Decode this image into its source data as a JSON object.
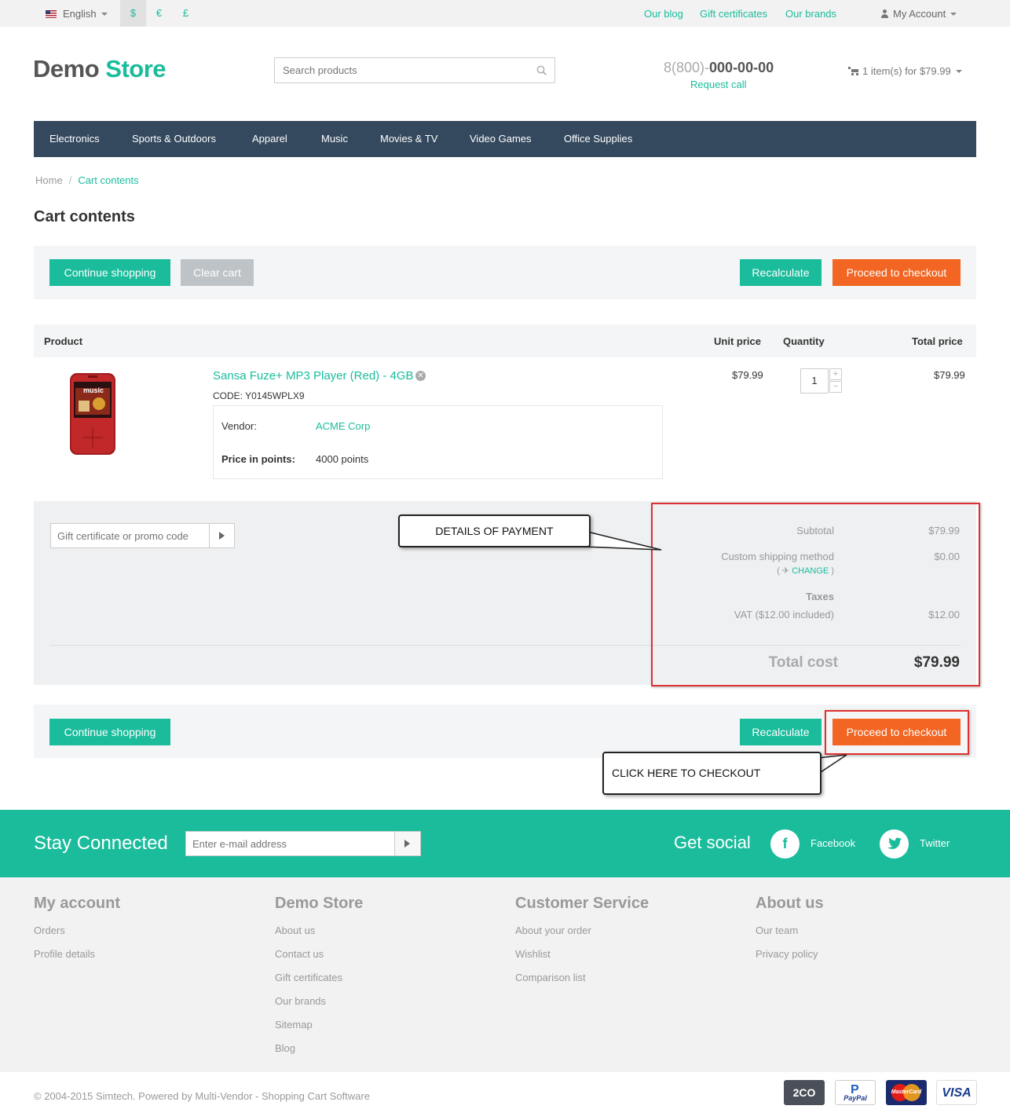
{
  "topbar": {
    "language": "English",
    "currencies": [
      "$",
      "€",
      "£"
    ],
    "links": [
      "Our blog",
      "Gift certificates",
      "Our brands"
    ],
    "account": "My Account"
  },
  "header": {
    "logo_part1": "Demo",
    "logo_part2": "Store",
    "search_placeholder": "Search products",
    "phone_prefix": "8(800)-",
    "phone_number": "000-00-00",
    "request_call": "Request call",
    "cart_summary": "1 item(s) for $79.99"
  },
  "nav": [
    "Electronics",
    "Sports & Outdoors",
    "Apparel",
    "Music",
    "Movies & TV",
    "Video Games",
    "Office Supplies"
  ],
  "breadcrumb": {
    "home": "Home",
    "separator": "/",
    "current": "Cart contents"
  },
  "page_title": "Cart contents",
  "buttons": {
    "continue_shopping": "Continue shopping",
    "clear_cart": "Clear cart",
    "recalculate": "Recalculate",
    "proceed_to_checkout": "Proceed to checkout"
  },
  "table": {
    "headers": {
      "product": "Product",
      "unit_price": "Unit price",
      "quantity": "Quantity",
      "total_price": "Total price"
    },
    "item": {
      "name": "Sansa Fuze+ MP3 Player (Red) - 4GB",
      "code": "CODE: Y0145WPLX9",
      "vendor_label": "Vendor:",
      "vendor": "ACME Corp",
      "points_label": "Price in points:",
      "points": "4000 points",
      "unit_price": "$79.99",
      "quantity": "1",
      "total_price": "$79.99",
      "image_text": "music"
    }
  },
  "summary": {
    "promo_placeholder": "Gift certificate or promo code",
    "subtotal_label": "Subtotal",
    "subtotal": "$79.99",
    "shipping_label": "Custom shipping method",
    "shipping_change": "CHANGE",
    "shipping": "$0.00",
    "taxes_label": "Taxes",
    "vat_label": "VAT ($12.00 included)",
    "vat": "$12.00",
    "total_label": "Total cost",
    "total": "$79.99"
  },
  "annotations": {
    "payment_details": "DETAILS OF PAYMENT",
    "click_checkout": "CLICK HERE TO CHECKOUT",
    "highlight_color": "#e03030"
  },
  "subscribe": {
    "title": "Stay Connected",
    "email_placeholder": "Enter e-mail address",
    "get_social": "Get social",
    "facebook": "Facebook",
    "twitter": "Twitter"
  },
  "footer": {
    "columns": [
      {
        "title": "My account",
        "links": [
          "Orders",
          "Profile details"
        ]
      },
      {
        "title": "Demo Store",
        "links": [
          "About us",
          "Contact us",
          "Gift certificates",
          "Our brands",
          "Sitemap",
          "Blog"
        ]
      },
      {
        "title": "Customer Service",
        "links": [
          "About your order",
          "Wishlist",
          "Comparison list"
        ]
      },
      {
        "title": "About us",
        "links": [
          "Our team",
          "Privacy policy"
        ]
      }
    ],
    "copyright": "© 2004-2015 Simtech.  Powered by Multi-Vendor - Shopping Cart Software",
    "payment_logos": [
      "2CO",
      "PayPal",
      "MasterCard",
      "VISA"
    ]
  },
  "colors": {
    "accent": "#1abc9c",
    "nav_bg": "#34495e",
    "checkout": "#f26522"
  }
}
